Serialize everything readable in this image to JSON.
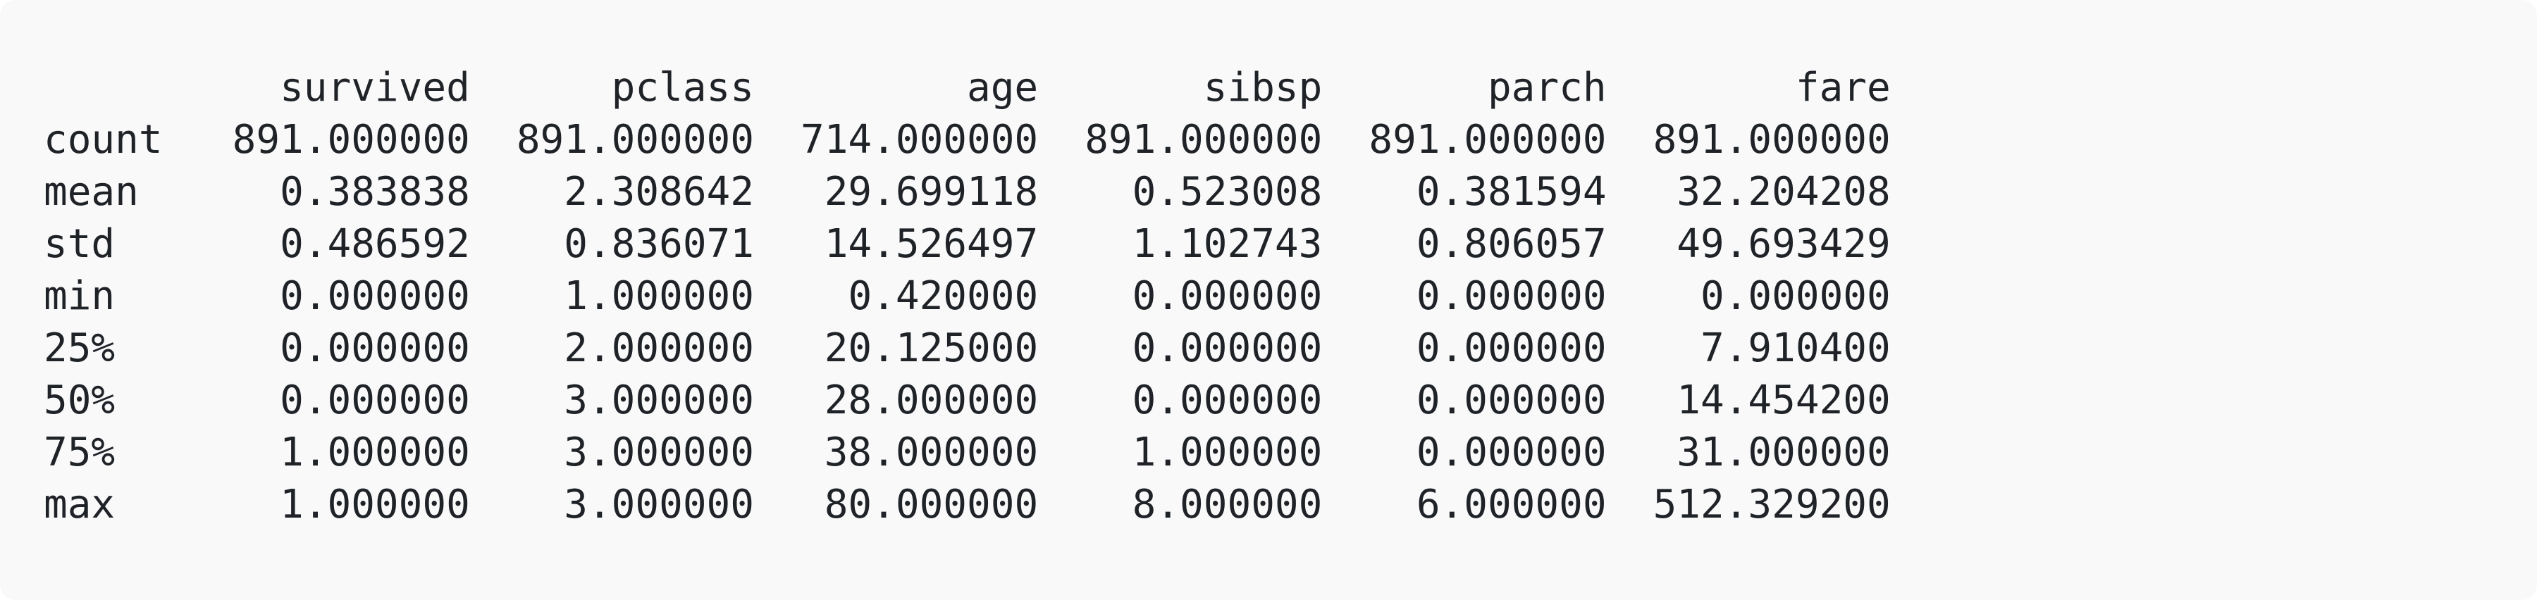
{
  "describe_table": {
    "columns": [
      "survived",
      "pclass",
      "age",
      "sibsp",
      "parch",
      "fare"
    ],
    "rows": [
      {
        "index": "count",
        "values": [
          "891.000000",
          "891.000000",
          "714.000000",
          "891.000000",
          "891.000000",
          "891.000000"
        ]
      },
      {
        "index": "mean",
        "values": [
          "0.383838",
          "2.308642",
          "29.699118",
          "0.523008",
          "0.381594",
          "32.204208"
        ]
      },
      {
        "index": "std",
        "values": [
          "0.486592",
          "0.836071",
          "14.526497",
          "1.102743",
          "0.806057",
          "49.693429"
        ]
      },
      {
        "index": "min",
        "values": [
          "0.000000",
          "1.000000",
          "0.420000",
          "0.000000",
          "0.000000",
          "0.000000"
        ]
      },
      {
        "index": "25%",
        "values": [
          "0.000000",
          "2.000000",
          "20.125000",
          "0.000000",
          "0.000000",
          "7.910400"
        ]
      },
      {
        "index": "50%",
        "values": [
          "0.000000",
          "3.000000",
          "28.000000",
          "0.000000",
          "0.000000",
          "14.454200"
        ]
      },
      {
        "index": "75%",
        "values": [
          "1.000000",
          "3.000000",
          "38.000000",
          "1.000000",
          "0.000000",
          "31.000000"
        ]
      },
      {
        "index": "max",
        "values": [
          "1.000000",
          "3.000000",
          "80.000000",
          "8.000000",
          "6.000000",
          "512.329200"
        ]
      }
    ]
  },
  "theme": {
    "panel_background": "#f9f9f9",
    "text_color": "#1f2328"
  }
}
